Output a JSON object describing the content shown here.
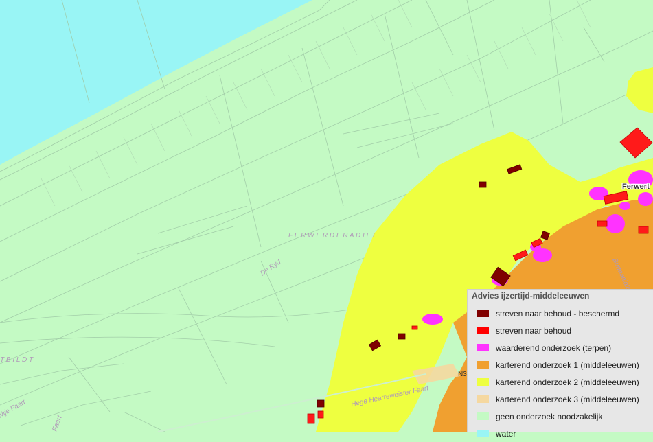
{
  "map": {
    "labels": {
      "region": "F E R W E R D E R A D I E L",
      "road_ryd": "De Ryd",
      "bildt": "T   B I L D T",
      "nije_faart": "Nije Faart",
      "faart_partial": "Faart",
      "hearreweister": "Hege Hearreweister Faart",
      "ferwert": "Ferwert",
      "burmania": "Burmanialaan",
      "road_n3": "N3"
    }
  },
  "legend": {
    "title": "Advies ijzertijd-middeleeuwen",
    "items": [
      {
        "label": "streven naar behoud - beschermd",
        "color": "#800000"
      },
      {
        "label": "streven naar behoud",
        "color": "#ff0000"
      },
      {
        "label": "waarderend onderzoek (terpen)",
        "color": "#ff33ff"
      },
      {
        "label": "karterend onderzoek 1 (middeleeuwen)",
        "color": "#f0a030"
      },
      {
        "label": "karterend onderzoek 2 (middeleeuwen)",
        "color": "#eeff40"
      },
      {
        "label": "karterend onderzoek 3 (middeleeuwen)",
        "color": "#f5d8a0"
      },
      {
        "label": "geen onderzoek noodzakelijk",
        "color": "#c4fac4"
      },
      {
        "label": "water",
        "color": "#99f5f5"
      }
    ]
  }
}
